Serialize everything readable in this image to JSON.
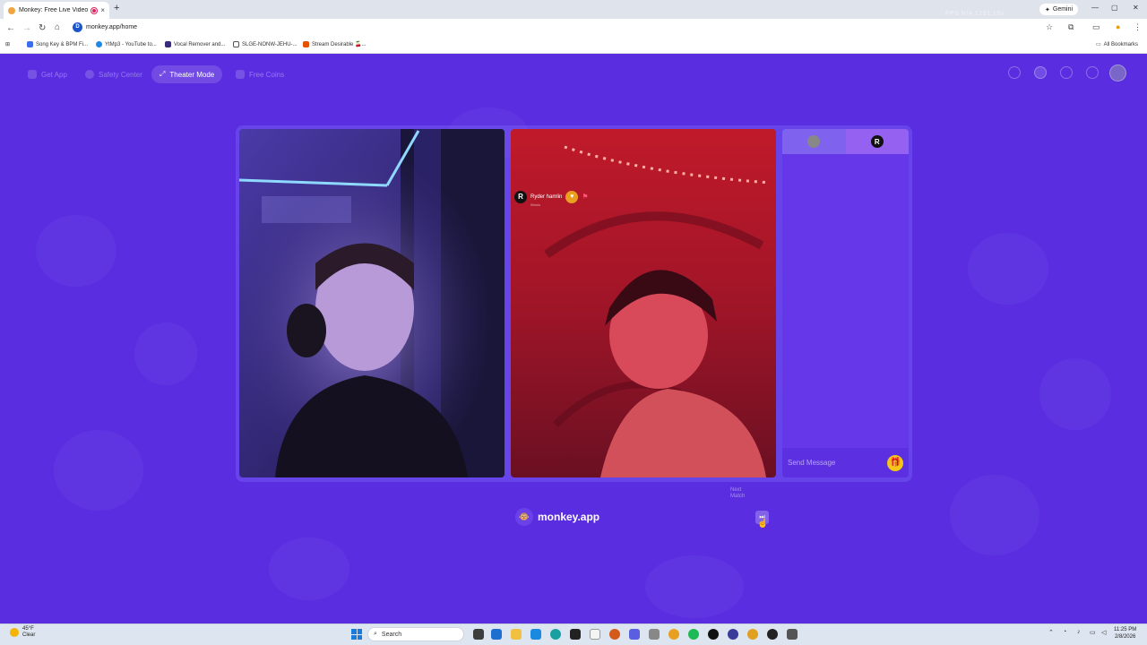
{
  "browser": {
    "tab_title": "Monkey: Free Live Video Ch",
    "tab_close": "×",
    "new_tab": "+",
    "url": "monkey.app/home",
    "url_badge": "D",
    "gemini_label": "Gemini",
    "gemini_glyph": "✦",
    "ghost_text": "FPS N/A   1231.15s",
    "window_controls": [
      "—",
      "▢",
      "✕"
    ],
    "nav": [
      "←",
      "→",
      "↻",
      "⌂"
    ],
    "bookmarks": [
      {
        "label": "Song Key & BPM Fi...",
        "color": "#3b6df0"
      },
      {
        "label": "YtMp3 - YouTube to...",
        "color": "#1e88e5"
      },
      {
        "label": "Vocal Remover and...",
        "color": "#3a2a7a"
      },
      {
        "label": "SLGE-NONW-JEHU-...",
        "color": "#555555"
      },
      {
        "label": "Stream Desirable 🍒...",
        "color": "#e65100"
      }
    ],
    "all_bookmarks": "All Bookmarks"
  },
  "page": {
    "topnav": {
      "get_app": "Get App",
      "safety": "Safety Center",
      "theater": "Theater Mode",
      "coins": "Free Coins"
    },
    "peer": {
      "initial": "R",
      "name": "Ryder hamlin",
      "subtitle": "Illinois",
      "heart": "♥",
      "flag": "⚑"
    },
    "brand": "monkey.app",
    "brand_glyph": "🐵",
    "next_match": "Next Match",
    "next_glyph": "⏭",
    "chat": {
      "avatar_right": "R",
      "placeholder": "Send Message",
      "gift": "🎁"
    }
  },
  "taskbar": {
    "temp": "45°F",
    "condition": "Clear",
    "search_placeholder": "Search",
    "time": "11:25 PM",
    "date": "2/8/2026"
  },
  "colors": {
    "page_bg": "#5a2ee0",
    "chat_bg": "#6637e8",
    "accent_gold": "#f5c518"
  }
}
